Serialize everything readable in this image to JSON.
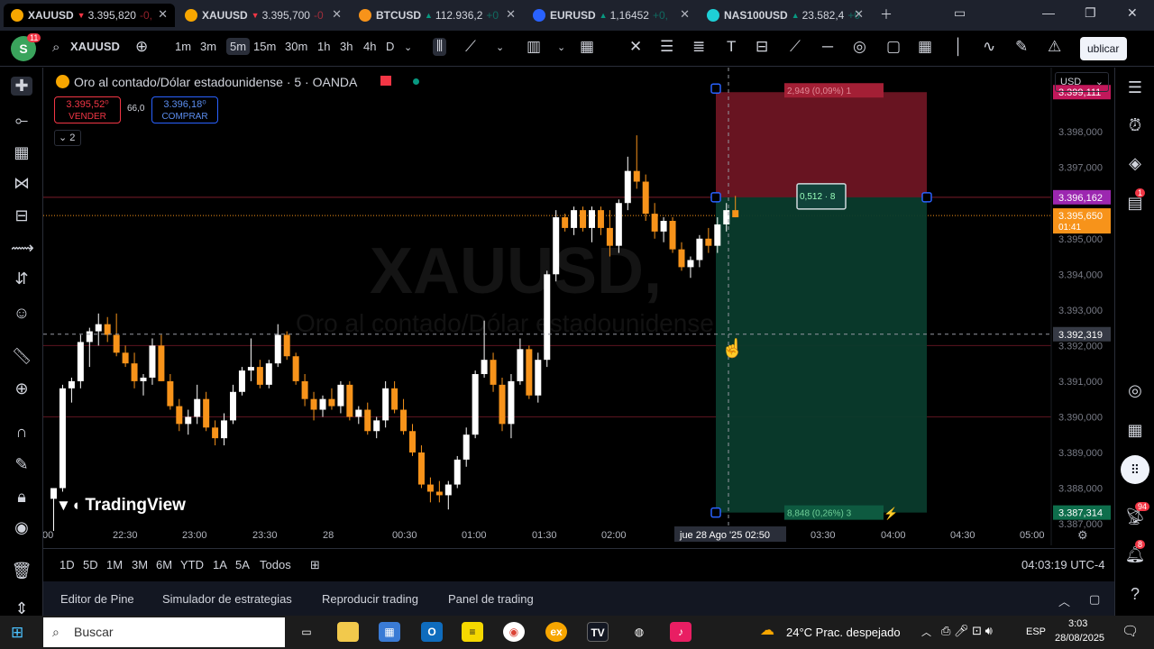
{
  "tabs": [
    {
      "symbol": "XAUUSD",
      "direction": "▼",
      "price": "3.395,820",
      "change": "-0,",
      "color": "#f23645",
      "icon_color": "#f7a600",
      "active": true
    },
    {
      "symbol": "XAUUSD",
      "direction": "▼",
      "price": "3.395,700",
      "change": "-0",
      "color": "#f23645",
      "icon_color": "#f7a600",
      "active": false
    },
    {
      "symbol": "BTCUSD",
      "direction": "▲",
      "price": "112.936,2",
      "change": "+0",
      "color": "#089981",
      "icon_color": "#f7931a",
      "active": false
    },
    {
      "symbol": "EURUSD",
      "direction": "▲",
      "price": "1,16452",
      "change": "+0,",
      "color": "#089981",
      "icon_color": "#2962ff",
      "active": false
    },
    {
      "symbol": "NAS100USD",
      "direction": "▲",
      "price": "23.582,4",
      "change": "+0",
      "color": "#089981",
      "icon_color": "#1ecfd6",
      "active": false
    }
  ],
  "toolbar": {
    "avatar_letter": "S",
    "avatar_badge": "11",
    "symbol": "XAUUSD",
    "intervals": [
      "1m",
      "3m",
      "5m",
      "15m",
      "30m",
      "1h",
      "3h",
      "4h",
      "D"
    ],
    "selected_interval": "5m",
    "publish_label": "ublicar"
  },
  "legend": {
    "title": "Oro al contado/Dólar estadounidense · 5 · OANDA",
    "sell_price": "3.395,52⁰",
    "sell_label": "VENDER",
    "spread": "66,0",
    "buy_price": "3.396,18⁰",
    "buy_label": "COMPRAR",
    "indicators_count": "2",
    "watermark_symbol": "XAUUSD,",
    "watermark_subtitle": "Oro al contado/Dólar estadounidense"
  },
  "price_axis": {
    "currency": "USD",
    "tick_labels": [
      "3.398,000",
      "3.397,000",
      "3.395,000",
      "3.394,000",
      "3.393,000",
      "3.392,000",
      "3.391,000",
      "3.390,000",
      "3.389,000",
      "3.388,000",
      "3.387,000"
    ],
    "labels": {
      "stop": "3.399,111",
      "entry": "3.396,162",
      "last_price": "3.395,650",
      "countdown": "01:41",
      "crosshair": "3.392,319",
      "target": "3.387,314"
    }
  },
  "position_tool": {
    "risk_label": "2,949 (0,09%) 1",
    "qty_label": "0,512 · 8",
    "reward_label": "8,848 (0,26%) 3"
  },
  "time_axis": {
    "ticks": [
      ":00",
      "22:30",
      "23:00",
      "23:30",
      "28",
      "00:30",
      "01:00",
      "01:30",
      "02:00",
      "03:30",
      "04:00",
      "04:30",
      "05:00"
    ],
    "crosshair_label": "jue 28 Ago '25   02:50"
  },
  "logo_text": "TradingView",
  "chart_data": {
    "type": "candlestick",
    "timeframe": "5",
    "ylim": [
      3386.9,
      3399.8
    ],
    "candles": [
      [
        3387.7,
        3388.0,
        3386.8,
        3388.0
      ],
      [
        3388.0,
        3390.9,
        3387.9,
        3390.8
      ],
      [
        3390.8,
        3391.1,
        3390.4,
        3391.0
      ],
      [
        3391.0,
        3392.3,
        3390.8,
        3392.1
      ],
      [
        3392.1,
        3392.5,
        3391.4,
        3392.4
      ],
      [
        3392.4,
        3392.9,
        3392.0,
        3392.6
      ],
      [
        3392.6,
        3392.8,
        3392.1,
        3392.3
      ],
      [
        3392.3,
        3392.9,
        3391.7,
        3391.8
      ],
      [
        3391.8,
        3392.0,
        3391.4,
        3391.5
      ],
      [
        3391.5,
        3391.8,
        3390.8,
        3391.0
      ],
      [
        3391.0,
        3391.2,
        3390.6,
        3391.1
      ],
      [
        3391.1,
        3392.2,
        3390.9,
        3392.0
      ],
      [
        3392.0,
        3392.3,
        3391.0,
        3391.0
      ],
      [
        3391.0,
        3391.2,
        3390.2,
        3390.3
      ],
      [
        3390.3,
        3390.5,
        3389.6,
        3389.8
      ],
      [
        3389.8,
        3390.2,
        3389.5,
        3390.0
      ],
      [
        3390.0,
        3390.9,
        3389.8,
        3390.5
      ],
      [
        3390.5,
        3390.7,
        3389.6,
        3389.7
      ],
      [
        3389.7,
        3389.9,
        3389.2,
        3389.4
      ],
      [
        3389.4,
        3390.1,
        3389.2,
        3389.9
      ],
      [
        3389.9,
        3390.9,
        3389.8,
        3390.7
      ],
      [
        3390.7,
        3391.4,
        3390.6,
        3391.3
      ],
      [
        3391.3,
        3392.2,
        3391.0,
        3391.4
      ],
      [
        3391.4,
        3391.6,
        3390.8,
        3390.9
      ],
      [
        3390.9,
        3391.6,
        3390.8,
        3391.5
      ],
      [
        3391.5,
        3392.6,
        3391.4,
        3392.3
      ],
      [
        3392.3,
        3392.4,
        3391.6,
        3391.7
      ],
      [
        3391.7,
        3391.8,
        3390.9,
        3391.0
      ],
      [
        3391.0,
        3391.2,
        3390.3,
        3390.5
      ],
      [
        3390.5,
        3390.7,
        3389.9,
        3390.2
      ],
      [
        3390.2,
        3390.6,
        3390.0,
        3390.5
      ],
      [
        3390.5,
        3390.8,
        3390.2,
        3390.3
      ],
      [
        3390.3,
        3391.0,
        3390.1,
        3390.9
      ],
      [
        3390.9,
        3391.0,
        3389.9,
        3390.0
      ],
      [
        3390.0,
        3390.3,
        3389.8,
        3390.2
      ],
      [
        3390.2,
        3390.4,
        3389.5,
        3389.6
      ],
      [
        3389.6,
        3390.0,
        3389.4,
        3389.9
      ],
      [
        3389.9,
        3391.0,
        3389.7,
        3390.8
      ],
      [
        3390.8,
        3391.0,
        3390.1,
        3390.2
      ],
      [
        3390.2,
        3390.5,
        3389.5,
        3389.6
      ],
      [
        3389.6,
        3389.8,
        3388.9,
        3389.0
      ],
      [
        3389.0,
        3389.2,
        3388.0,
        3388.1
      ],
      [
        3388.1,
        3388.3,
        3387.6,
        3387.9
      ],
      [
        3387.9,
        3388.2,
        3387.6,
        3387.8
      ],
      [
        3387.8,
        3388.2,
        3387.4,
        3388.1
      ],
      [
        3388.1,
        3388.9,
        3388.0,
        3388.8
      ],
      [
        3388.8,
        3389.7,
        3388.6,
        3389.5
      ],
      [
        3389.5,
        3391.3,
        3389.4,
        3391.2
      ],
      [
        3391.2,
        3392.7,
        3391.1,
        3391.6
      ],
      [
        3391.6,
        3391.8,
        3390.7,
        3390.9
      ],
      [
        3390.9,
        3391.1,
        3389.6,
        3389.8
      ],
      [
        3389.8,
        3391.2,
        3389.4,
        3391.0
      ],
      [
        3391.0,
        3392.2,
        3390.9,
        3391.9
      ],
      [
        3391.9,
        3392.0,
        3390.5,
        3390.6
      ],
      [
        3390.6,
        3391.8,
        3390.4,
        3391.6
      ],
      [
        3391.6,
        3394.1,
        3391.4,
        3394.0
      ],
      [
        3394.0,
        3395.8,
        3393.8,
        3395.6
      ],
      [
        3395.6,
        3395.7,
        3395.2,
        3395.3
      ],
      [
        3395.3,
        3395.9,
        3395.1,
        3395.8
      ],
      [
        3395.8,
        3395.9,
        3395.2,
        3395.3
      ],
      [
        3395.3,
        3395.9,
        3394.9,
        3395.8
      ],
      [
        3395.8,
        3395.9,
        3395.1,
        3395.3
      ],
      [
        3395.3,
        3395.8,
        3394.5,
        3394.8
      ],
      [
        3394.8,
        3396.1,
        3394.6,
        3396.0
      ],
      [
        3396.0,
        3397.3,
        3395.8,
        3396.9
      ],
      [
        3396.9,
        3397.9,
        3396.4,
        3396.6
      ],
      [
        3396.6,
        3396.8,
        3395.5,
        3395.7
      ],
      [
        3395.7,
        3396.0,
        3395.0,
        3395.2
      ],
      [
        3395.2,
        3395.6,
        3394.9,
        3395.5
      ],
      [
        3395.5,
        3395.6,
        3394.6,
        3394.7
      ],
      [
        3394.7,
        3394.9,
        3394.1,
        3394.2
      ],
      [
        3394.2,
        3394.5,
        3393.9,
        3394.4
      ],
      [
        3394.4,
        3395.1,
        3394.2,
        3395.0
      ],
      [
        3395.0,
        3395.3,
        3394.6,
        3394.8
      ],
      [
        3394.8,
        3395.6,
        3394.6,
        3395.4
      ],
      [
        3395.4,
        3396.0,
        3395.2,
        3395.8
      ],
      [
        3395.8,
        3396.2,
        3395.6,
        3395.6
      ]
    ]
  },
  "range_bar": {
    "ranges": [
      "1D",
      "5D",
      "1M",
      "3M",
      "6M",
      "YTD",
      "1A",
      "5A",
      "Todos"
    ],
    "clock": "04:03:19 UTC-4"
  },
  "panel_bar": {
    "items": [
      "Editor de Pine",
      "Simulador de estrategias",
      "Reproducir trading",
      "Panel de trading"
    ]
  },
  "taskbar": {
    "search_placeholder": "Buscar",
    "weather": "24°C  Prac. despejado",
    "lang": "ESP",
    "time": "3:03",
    "date": "28/08/2025"
  },
  "right_badges": [
    "1",
    "94",
    "8"
  ],
  "colors": {
    "up": "#ffffff",
    "down": "#f7931a",
    "risk_zone": "#6e1523",
    "reward_zone": "#0a3b2c",
    "entry_label": "#9c27b0",
    "last_price_label": "#f7931a",
    "stop_label": "#c2185b",
    "target_label": "#0e6e4c"
  }
}
